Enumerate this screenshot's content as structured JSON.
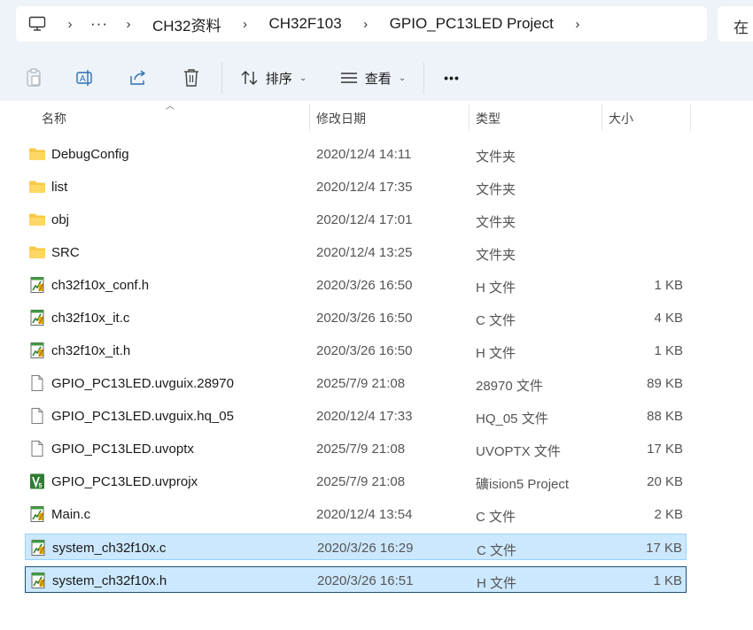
{
  "breadcrumb": {
    "more": "···",
    "items": [
      "CH32资料",
      "CH32F103",
      "GPIO_PC13LED Project"
    ],
    "separator": "›"
  },
  "search": {
    "prefix_text": "在"
  },
  "toolbar": {
    "sort_label": "排序",
    "view_label": "查看",
    "more_label": "•••"
  },
  "columns": {
    "name": "名称",
    "date": "修改日期",
    "type": "类型",
    "size": "大小"
  },
  "files": [
    {
      "name": "DebugConfig",
      "date": "2020/12/4 14:11",
      "type": "文件夹",
      "size": "",
      "icon": "folder-icon"
    },
    {
      "name": "list",
      "date": "2020/12/4 17:35",
      "type": "文件夹",
      "size": "",
      "icon": "folder-icon"
    },
    {
      "name": "obj",
      "date": "2020/12/4 17:01",
      "type": "文件夹",
      "size": "",
      "icon": "folder-icon"
    },
    {
      "name": "SRC",
      "date": "2020/12/4 13:25",
      "type": "文件夹",
      "size": "",
      "icon": "folder-icon"
    },
    {
      "name": "ch32f10x_conf.h",
      "date": "2020/3/26 16:50",
      "type": "H 文件",
      "size": "1 KB",
      "icon": "source-file-icon"
    },
    {
      "name": "ch32f10x_it.c",
      "date": "2020/3/26 16:50",
      "type": "C 文件",
      "size": "4 KB",
      "icon": "source-file-icon"
    },
    {
      "name": "ch32f10x_it.h",
      "date": "2020/3/26 16:50",
      "type": "H 文件",
      "size": "1 KB",
      "icon": "source-file-icon"
    },
    {
      "name": "GPIO_PC13LED.uvguix.28970",
      "date": "2025/7/9 21:08",
      "type": "28970 文件",
      "size": "89 KB",
      "icon": "blank-file-icon"
    },
    {
      "name": "GPIO_PC13LED.uvguix.hq_05",
      "date": "2020/12/4 17:33",
      "type": "HQ_05 文件",
      "size": "88 KB",
      "icon": "blank-file-icon"
    },
    {
      "name": "GPIO_PC13LED.uvoptx",
      "date": "2025/7/9 21:08",
      "type": "UVOPTX 文件",
      "size": "17 KB",
      "icon": "blank-file-icon"
    },
    {
      "name": "GPIO_PC13LED.uvprojx",
      "date": "2025/7/9 21:08",
      "type": "礦ision5 Project",
      "size": "20 KB",
      "icon": "keil-project-icon"
    },
    {
      "name": "Main.c",
      "date": "2020/12/4 13:54",
      "type": "C 文件",
      "size": "2 KB",
      "icon": "source-file-icon"
    },
    {
      "name": "system_ch32f10x.c",
      "date": "2020/3/26 16:29",
      "type": "C 文件",
      "size": "17 KB",
      "icon": "source-file-icon",
      "selected": true
    },
    {
      "name": "system_ch32f10x.h",
      "date": "2020/3/26 16:51",
      "type": "H 文件",
      "size": "1 KB",
      "icon": "source-file-icon",
      "selected": true,
      "focused": true
    }
  ],
  "colors": {
    "selection_bg": "#cce8ff",
    "selection_border": "#99d1ff",
    "focus_border": "#1f4e79",
    "folder": "#f8c948",
    "chrome_bg": "#eef3f9"
  }
}
